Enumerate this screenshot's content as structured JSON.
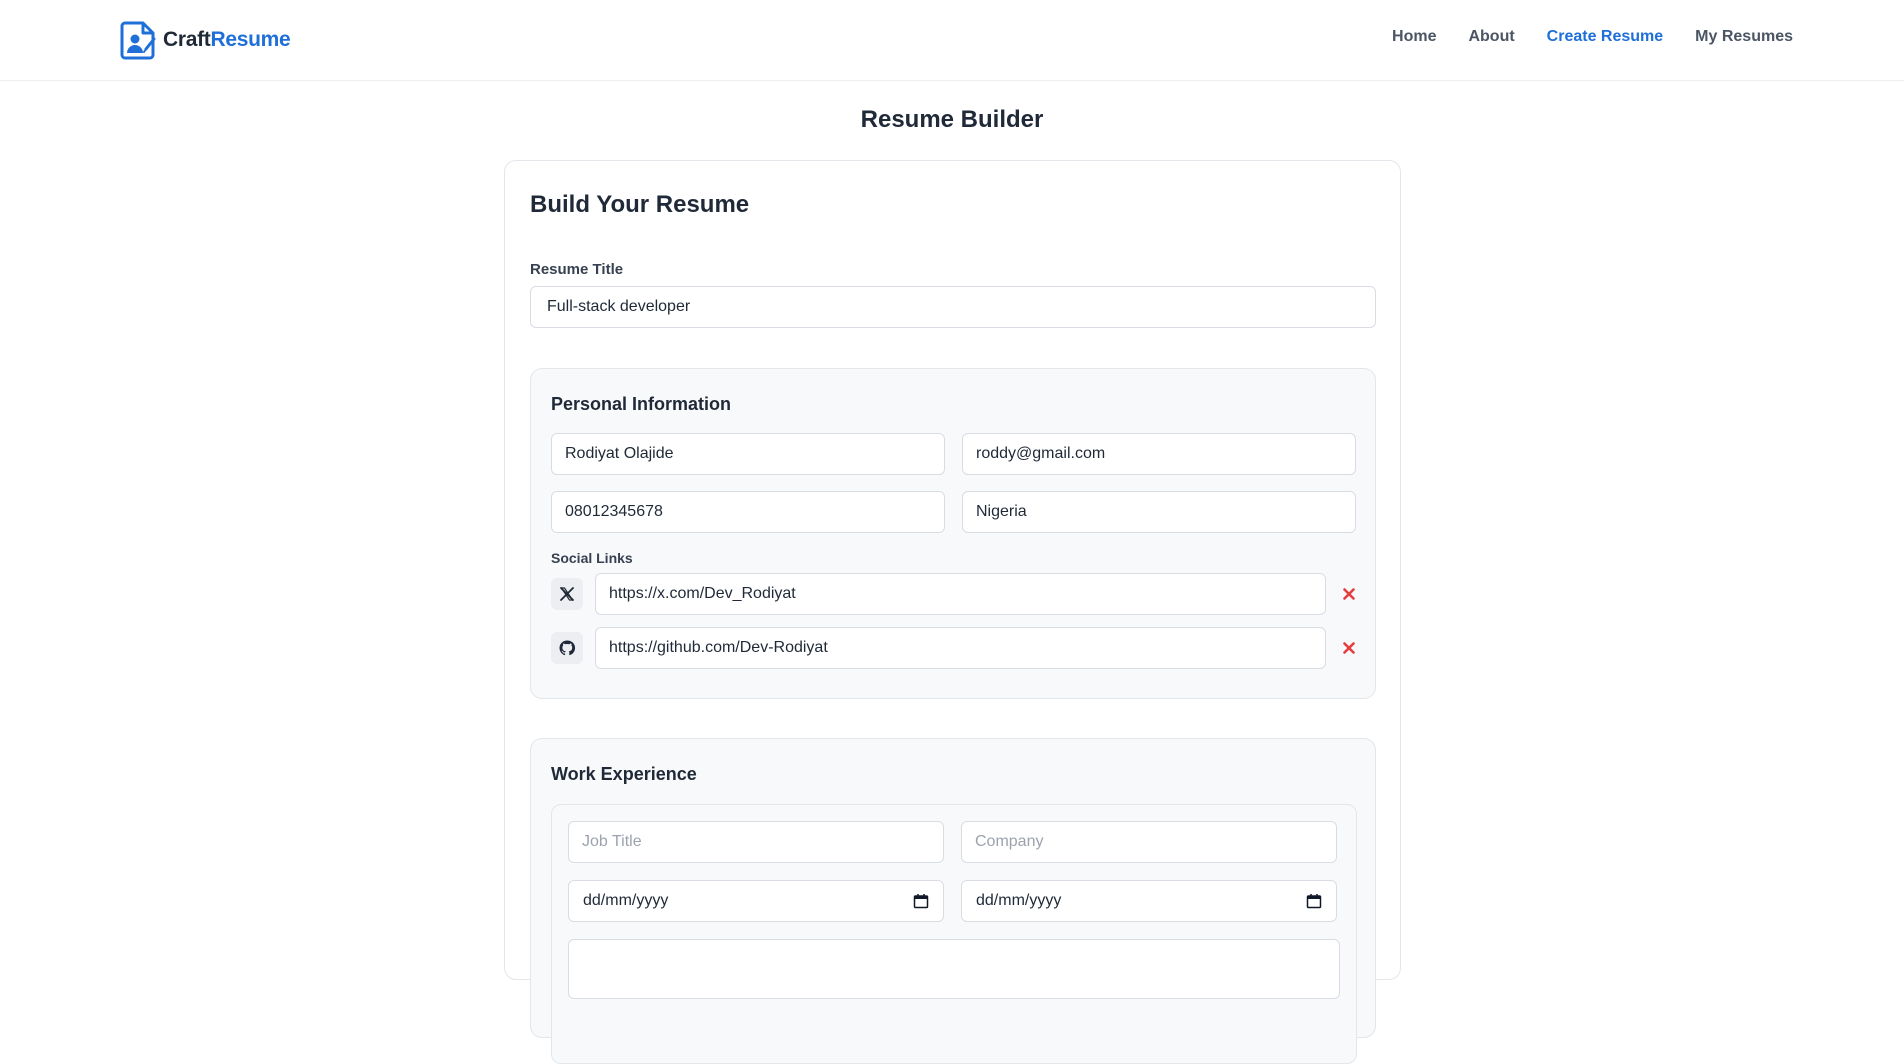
{
  "brand": {
    "craft": "Craft",
    "resume": "Resume"
  },
  "nav": [
    {
      "label": "Home",
      "active": false
    },
    {
      "label": "About",
      "active": false
    },
    {
      "label": "Create Resume",
      "active": true
    },
    {
      "label": "My Resumes",
      "active": false
    }
  ],
  "page_title": "Resume Builder",
  "card": {
    "title": "Build Your Resume",
    "resume_title_label": "Resume Title",
    "resume_title_value": "Full-stack developer"
  },
  "personal": {
    "title": "Personal Information",
    "name": "Rodiyat Olajide",
    "email": "roddy@gmail.com",
    "phone": "08012345678",
    "country": "Nigeria",
    "social_heading": "Social Links",
    "social_links": [
      {
        "icon": "x-icon",
        "url": "https://x.com/Dev_Rodiyat"
      },
      {
        "icon": "github-icon",
        "url": "https://github.com/Dev-Rodiyat"
      }
    ]
  },
  "work": {
    "title": "Work Experience",
    "job_title_placeholder": "Job Title",
    "company_placeholder": "Company",
    "start_date": "dd/mm/yyyy",
    "end_date": "dd/mm/yyyy"
  },
  "colors": {
    "accent": "#1f6fd9",
    "danger": "#e53e3e",
    "text": "#1f2937"
  }
}
